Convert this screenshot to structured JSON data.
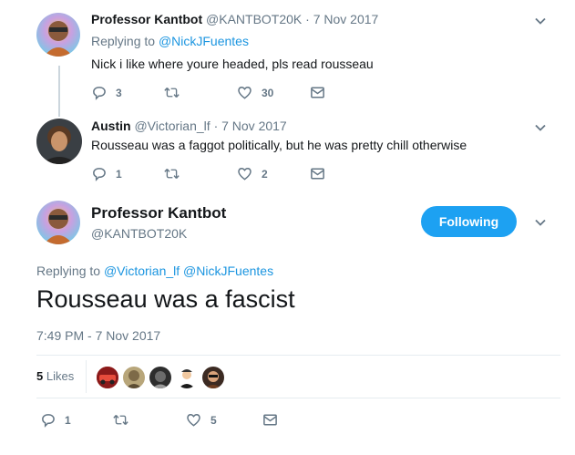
{
  "tweet1": {
    "name": "Professor Kantbot",
    "handle": "@KANTBOT20K",
    "date": "· 7 Nov 2017",
    "replying_prefix": "Replying to",
    "replying_to": "@NickJFuentes",
    "text": "Nick i like where youre headed, pls read rousseau",
    "replies": "3",
    "retweets": "",
    "likes": "30"
  },
  "tweet2": {
    "name": "Austin",
    "handle": "@Victorian_lf",
    "date": "· 7 Nov 2017",
    "text": "Rousseau was a faggot politically, but he was pretty chill otherwise",
    "replies": "1",
    "retweets": "",
    "likes": "2"
  },
  "main": {
    "name": "Professor Kantbot",
    "handle": "@KANTBOT20K",
    "follow_label": "Following",
    "replying_prefix": "Replying to",
    "replying_to_1": "@Victorian_lf",
    "replying_to_2": "@NickJFuentes",
    "text": "Rousseau was a fascist",
    "timestamp": "7:49 PM - 7 Nov 2017",
    "likes_count": "5",
    "likes_label": "Likes",
    "replies": "1",
    "retweets": "",
    "likes": "5"
  },
  "colors": {
    "accent": "#1da1f2",
    "link": "#1b95e0",
    "muted": "#657786",
    "thread_line": "#ccd6dd"
  }
}
